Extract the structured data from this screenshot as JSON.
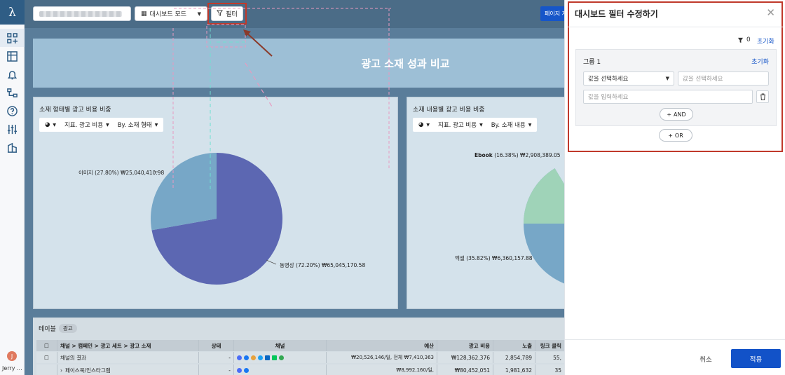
{
  "sidebar": {
    "logo": "λ",
    "user_initial": "J",
    "user_name": "Jerry ..."
  },
  "topbar": {
    "mode_label": "대시보드 모드",
    "filter_label": "필터",
    "page_button_label": "페이지 저"
  },
  "banner": {
    "title": "광고 소재 성과 비교"
  },
  "charts": [
    {
      "title": "소재 형태별 광고 비용 비중",
      "metric_label": "지표. 광고 비용",
      "dimension_label": "By. 소재 형태",
      "labels": [
        {
          "name": "이미지",
          "pct": "(27.80%)",
          "amount": "₩25,040,410.98"
        },
        {
          "name": "동영상",
          "pct": "(72.20%)",
          "amount": "₩65,045,170.58"
        }
      ]
    },
    {
      "title": "소재 내용별 광고 비용 비중",
      "metric_label": "지표. 광고 비용",
      "dimension_label": "By. 소재 내용",
      "labels": [
        {
          "name": "Ebook",
          "pct": "(16.38%)",
          "amount": "₩2,908,389.05"
        },
        {
          "name": "엑셀",
          "pct": "(35.82%)",
          "amount": "₩6,360,157.88"
        }
      ]
    }
  ],
  "chart_data": [
    {
      "type": "pie",
      "title": "소재 형태별 광고 비용 비중",
      "categories": [
        "이미지",
        "동영상"
      ],
      "values": [
        25040410.98,
        65045170.58
      ],
      "percents": [
        27.8,
        72.2
      ],
      "colors": [
        "#77a7c7",
        "#5c67b2"
      ]
    },
    {
      "type": "pie",
      "title": "소재 내용별 광고 비용 비중",
      "categories": [
        "Ebook",
        "엑셀"
      ],
      "values": [
        2908389.05,
        6360157.88
      ],
      "percents": [
        16.38,
        35.82
      ],
      "colors": [
        "#9fd3b8",
        "#77a7c7"
      ]
    }
  ],
  "table": {
    "title": "테이블",
    "tag": "광고",
    "columns": [
      "채널 > 캠페인 > 광고 세트 > 광고 소재",
      "상태",
      "채널",
      "예산",
      "광고 비용",
      "노출",
      "링크 클릭"
    ],
    "rows": [
      {
        "name": "채널의 결과",
        "status": "-",
        "budget": "₩20,526,146/일, 전체 ₩7,410,363",
        "cost": "₩128,362,376",
        "impressions": "2,854,789",
        "clicks": "55,"
      },
      {
        "name": "페이스북/인스타그램",
        "status": "-",
        "budget": "₩8,992,160/일,",
        "cost": "₩80,452,051",
        "impressions": "1,981,632",
        "clicks": "35"
      }
    ]
  },
  "drawer": {
    "title": "대시보드 필터 수정하기",
    "count": "0",
    "reset_label": "초기화",
    "group_name": "그룹 1",
    "group_reset": "초기화",
    "field_select_placeholder": "값을 선택하세요",
    "value_select_placeholder": "값을 선택하세요",
    "value_input_placeholder": "값을 입력하세요",
    "and_label": "AND",
    "or_label": "OR",
    "cancel_label": "취소",
    "apply_label": "적용"
  }
}
